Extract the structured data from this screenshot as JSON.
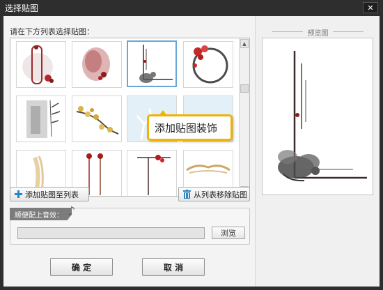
{
  "window": {
    "title": "选择贴图",
    "close_symbol": "✕"
  },
  "instruction": "请在下方列表选择贴图：",
  "gallery": {
    "thumbnails": [
      {
        "name": "thumb-red-frame-ornament",
        "selected": false
      },
      {
        "name": "thumb-ink-wash-bloom",
        "selected": false
      },
      {
        "name": "thumb-ink-corner-flower",
        "selected": true
      },
      {
        "name": "thumb-ink-circle-plum",
        "selected": false
      },
      {
        "name": "thumb-bamboo-ink",
        "selected": false
      },
      {
        "name": "thumb-yellow-plum-blossom",
        "selected": false
      },
      {
        "name": "thumb-pale-coral",
        "selected": false
      },
      {
        "name": "thumb-pale-coral-right",
        "selected": false
      },
      {
        "name": "thumb-gold-brush",
        "selected": false
      },
      {
        "name": "thumb-hanging-tassels",
        "selected": false
      },
      {
        "name": "thumb-red-berry-frame",
        "selected": false
      },
      {
        "name": "thumb-gold-lace-border",
        "selected": false
      }
    ],
    "scroll_up": "▲",
    "scroll_down": "▼"
  },
  "tooltip": {
    "text": "添加贴图装饰"
  },
  "buttons": {
    "add": "添加贴图至列表",
    "remove": "从列表移除贴图",
    "ok": "确 定",
    "cancel": "取 消",
    "browse": "浏览"
  },
  "audio": {
    "label": "顺便配上音效：",
    "value": ""
  },
  "preview": {
    "label": "预览图"
  },
  "colors": {
    "titlebar": "#2e2e2e",
    "tooltip_border": "#f0b400",
    "selection_border": "#6aa6d6",
    "add_icon": "#1e88d0",
    "trash_icon": "#2d86c4"
  }
}
